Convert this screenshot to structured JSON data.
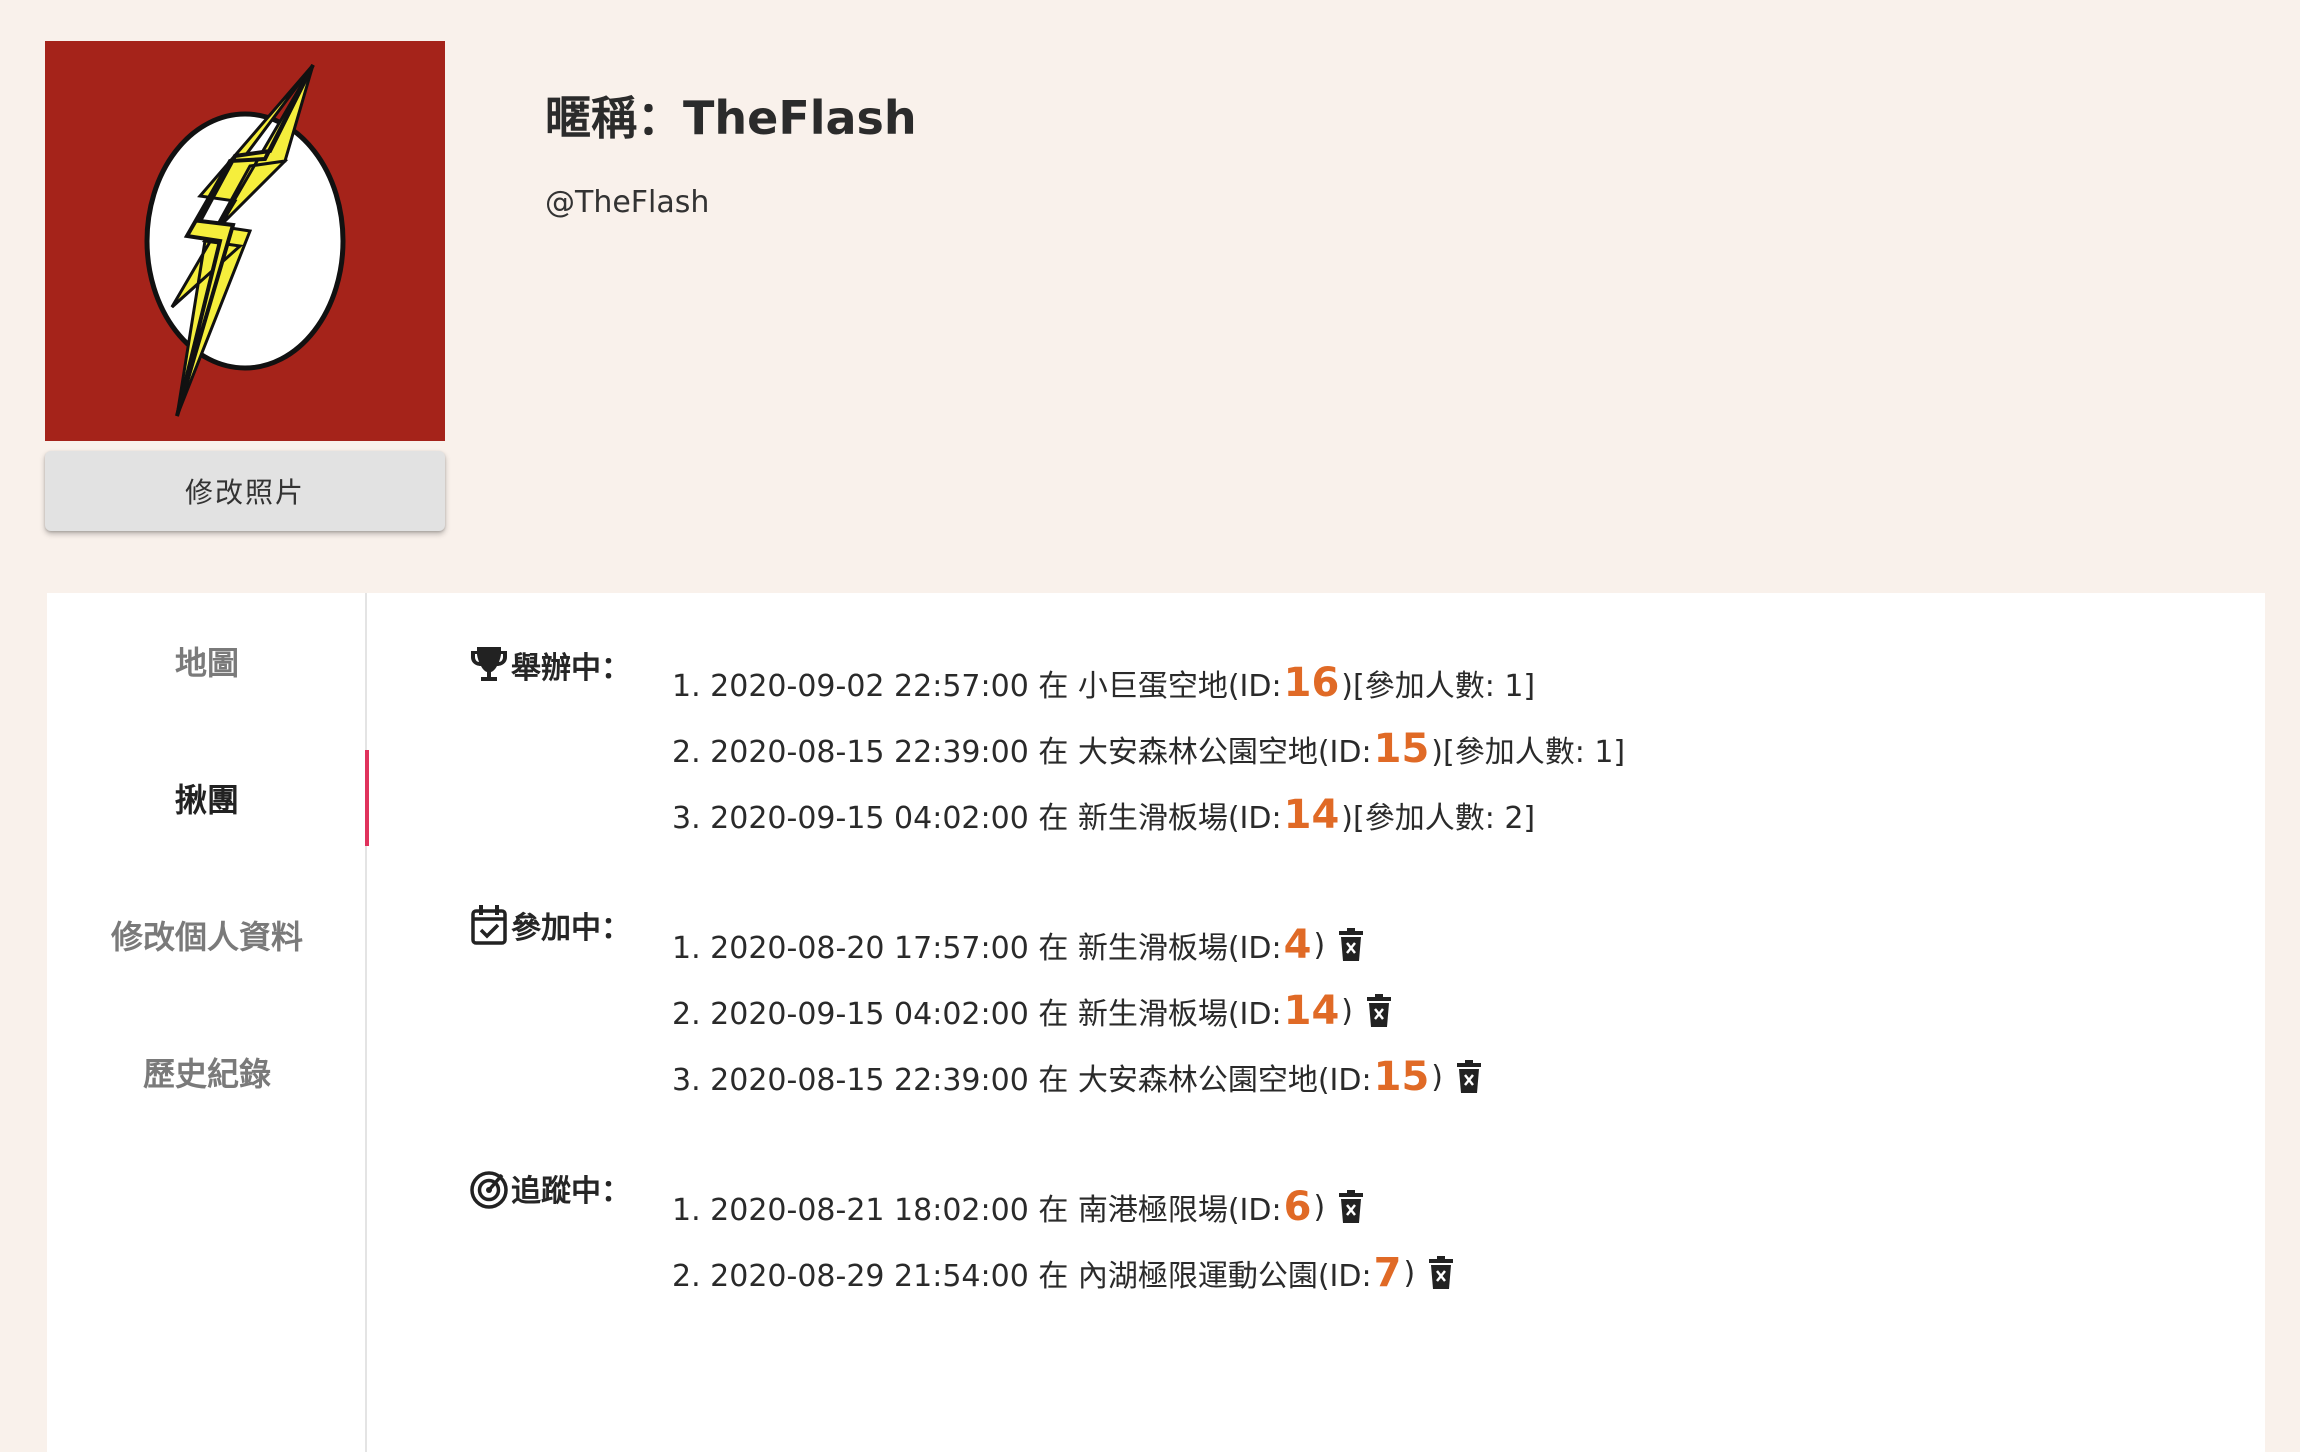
{
  "profile": {
    "nickname": "暱稱：TheFlash",
    "handle": "@TheFlash",
    "change_photo_label": "修改照片",
    "avatar_icon": "flash-lightning-logo",
    "avatar_bg": "#a5231a"
  },
  "nav": {
    "items": [
      {
        "label": "地圖",
        "active": false
      },
      {
        "label": "揪團",
        "active": true
      },
      {
        "label": "修改個人資料",
        "active": false
      },
      {
        "label": "歷史紀錄",
        "active": false
      }
    ]
  },
  "sections": {
    "hosting": {
      "icon": "trophy-icon",
      "title": "舉辦中：",
      "items": [
        {
          "prefix": "1. 2020-09-02 22:57:00 在 小巨蛋空地(ID: ",
          "id": "16",
          "suffix": ")[參加人數: 1]"
        },
        {
          "prefix": "2. 2020-08-15 22:39:00 在 大安森林公園空地(ID: ",
          "id": "15",
          "suffix": ")[參加人數: 1]"
        },
        {
          "prefix": "3. 2020-09-15 04:02:00 在 新生滑板場(ID: ",
          "id": "14",
          "suffix": ")[參加人數: 2]"
        }
      ]
    },
    "joined": {
      "icon": "calendar-check-icon",
      "title": "參加中：",
      "items": [
        {
          "prefix": "1. 2020-08-20 17:57:00 在 新生滑板場(ID: ",
          "id": "4",
          "suffix": ")"
        },
        {
          "prefix": "2. 2020-09-15 04:02:00 在 新生滑板場(ID: ",
          "id": "14",
          "suffix": ")"
        },
        {
          "prefix": "3. 2020-08-15 22:39:00 在 大安森林公園空地(ID: ",
          "id": "15",
          "suffix": ")"
        }
      ]
    },
    "tracking": {
      "icon": "radar-icon",
      "title": "追蹤中：",
      "items": [
        {
          "prefix": "1. 2020-08-21 18:02:00 在 南港極限場(ID: ",
          "id": "6",
          "suffix": ")"
        },
        {
          "prefix": "2. 2020-08-29 21:54:00 在 內湖極限運動公園(ID: ",
          "id": "7",
          "suffix": ")"
        }
      ]
    }
  },
  "colors": {
    "page_bg": "#f9f1eb",
    "id_accent": "#e06a26",
    "active_indicator": "#e0325c"
  }
}
